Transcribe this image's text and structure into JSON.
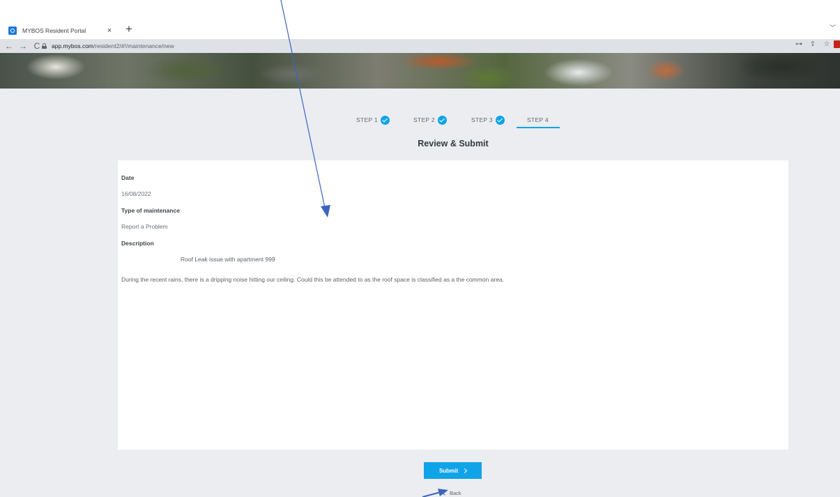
{
  "browser": {
    "tab_title": "MYBOS Resident Portal",
    "tab_close": "×",
    "new_tab": "+",
    "strip_chevron": "﹀",
    "nav_back": "←",
    "nav_forward": "→",
    "nav_reload": "C",
    "url_host": "app.mybos.com",
    "url_path": "/resident2/#!/maintenance/new",
    "icon_key": "⊶",
    "icon_share": "⇪",
    "icon_star": "☆"
  },
  "stepper": {
    "steps": [
      {
        "label": "STEP 1",
        "completed": true
      },
      {
        "label": "STEP 2",
        "completed": true
      },
      {
        "label": "STEP 3",
        "completed": true
      },
      {
        "label": "STEP 4",
        "completed": false,
        "active": true
      }
    ]
  },
  "page": {
    "title": "Review & Submit"
  },
  "review": {
    "date_label": "Date",
    "date_value": "16/08/2022",
    "type_label": "Type of maintenance",
    "type_value": "Report a Problem",
    "description_label": "Description",
    "description_title": "Roof Leak issue with apartment 999",
    "description_body": "During the recent rains, there is a dripping noise hitting our ceiling.  Could this be attended to as the roof space is classified as a the common area."
  },
  "actions": {
    "submit_label": "Submit",
    "back_label": "Back"
  },
  "colors": {
    "accent": "#11a3e8",
    "background": "#ebedf0",
    "annotation": "#3b64c0"
  }
}
